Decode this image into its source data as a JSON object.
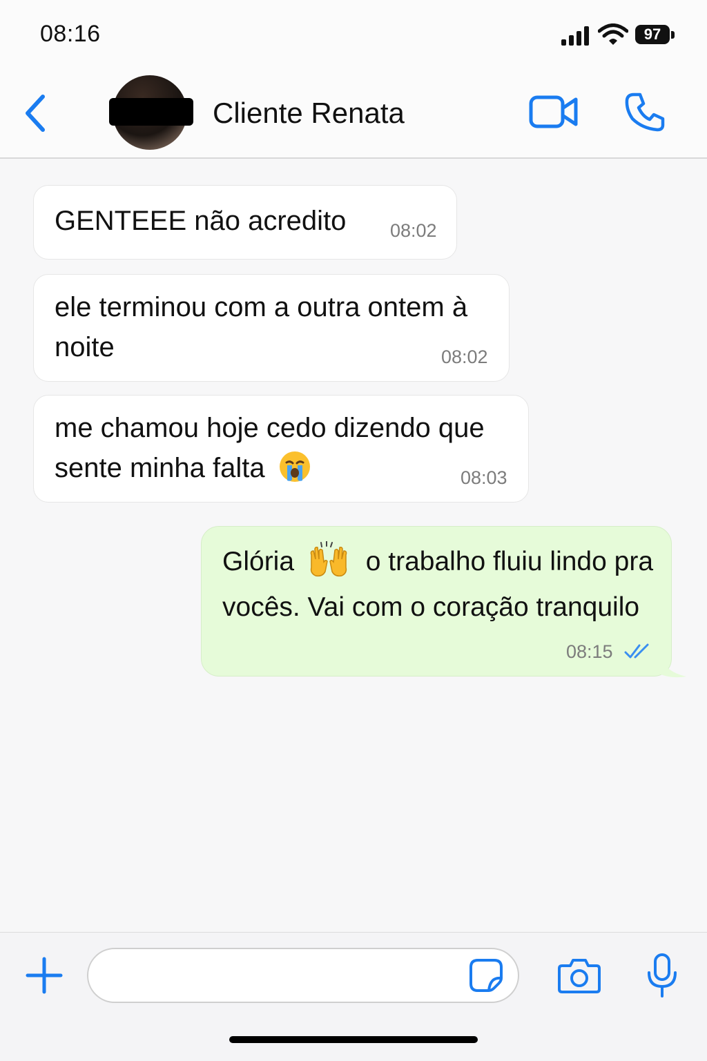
{
  "status_bar": {
    "time": "08:16",
    "battery": "97"
  },
  "header": {
    "contact_name": "Cliente Renata"
  },
  "messages": [
    {
      "direction": "in",
      "lines": [
        "GENTEEE não acredito"
      ],
      "time": "08:02"
    },
    {
      "direction": "in",
      "lines": [
        "ele terminou com a outra ontem à",
        "noite"
      ],
      "time": "08:02"
    },
    {
      "direction": "in",
      "lines": [
        "me chamou hoje cedo dizendo que",
        "sente minha falta"
      ],
      "emoji": "crying-face",
      "time": "08:03"
    },
    {
      "direction": "out",
      "line1_start": "Glória",
      "emoji": "raising-hands",
      "line1_end": "o trabalho fluiu lindo pra",
      "line2": "vocês. Vai com o coração tranquilo",
      "time": "08:15",
      "status": "read"
    }
  ],
  "composer": {
    "placeholder": ""
  },
  "colors": {
    "accent": "#1a7cf0",
    "outgoing_bubble": "#e6fbd9",
    "incoming_bubble": "#ffffff",
    "read_ticks": "#3a8ef0"
  }
}
